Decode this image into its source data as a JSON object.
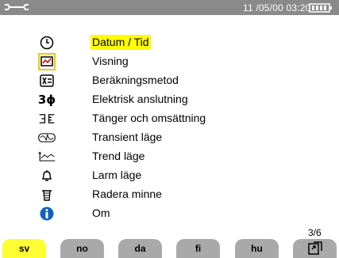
{
  "status_bar": {
    "datetime": "11 /05/00  03:20",
    "wrench_icon": "wrench-icon",
    "battery_icon": "battery-icon"
  },
  "menu": {
    "items": [
      {
        "label": "Datum / Tid",
        "icon": "clock-icon",
        "selected": true
      },
      {
        "label": "Visning",
        "icon": "display-icon",
        "selected": false
      },
      {
        "label": "Beräkningsmetod",
        "icon": "calculation-icon",
        "selected": false
      },
      {
        "label": "Elektrisk anslutning",
        "icon": "three-phase-icon",
        "icon_text": "3ϕ",
        "selected": false
      },
      {
        "label": "Tänger och omsättning",
        "icon": "clamp-icon",
        "selected": false
      },
      {
        "label": "Transient läge",
        "icon": "transient-icon",
        "selected": false
      },
      {
        "label": "Trend läge",
        "icon": "trend-icon",
        "selected": false
      },
      {
        "label": "Larm läge",
        "icon": "alarm-bell-icon",
        "selected": false
      },
      {
        "label": "Radera minne",
        "icon": "trash-icon",
        "selected": false
      },
      {
        "label": "Om",
        "icon": "info-icon",
        "selected": false
      }
    ]
  },
  "page_indicator": "3/6",
  "tabs": [
    {
      "label": "sv",
      "active": true
    },
    {
      "label": "no",
      "active": false
    },
    {
      "label": "da",
      "active": false
    },
    {
      "label": "fi",
      "active": false
    },
    {
      "label": "hu",
      "active": false
    },
    {
      "label": "",
      "icon": "return-icon",
      "active": false
    }
  ],
  "colors": {
    "highlight": "#ffff00",
    "status_bar": "#8a8a8a",
    "tab_inactive": "#a9a9a9",
    "info_blue": "#1060c0"
  }
}
